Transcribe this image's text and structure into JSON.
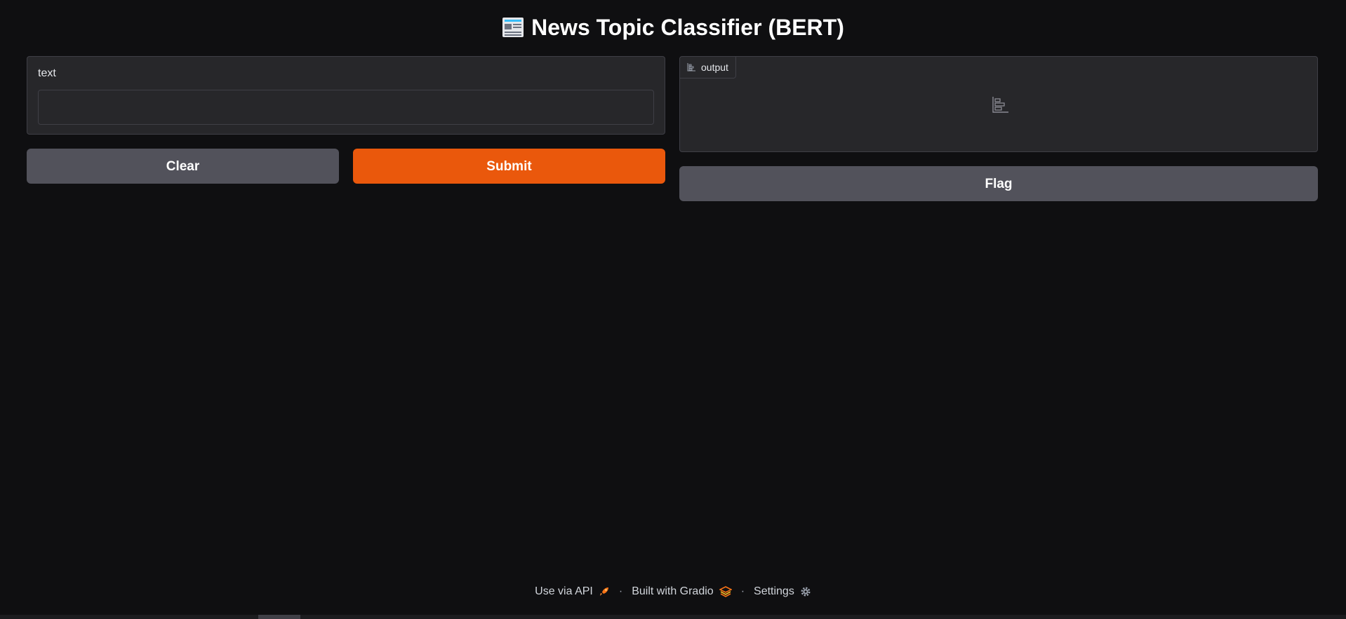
{
  "header": {
    "title": "News Topic Classifier (BERT)",
    "title_icon": "newspaper-icon"
  },
  "input": {
    "label": "text",
    "value": "",
    "placeholder": ""
  },
  "buttons": {
    "clear_label": "Clear",
    "submit_label": "Submit",
    "flag_label": "Flag"
  },
  "output": {
    "label": "output",
    "label_icon": "bar-chart-icon",
    "empty_icon": "bar-chart-icon"
  },
  "footer": {
    "api_label": "Use via API",
    "api_icon": "rocket-icon",
    "separator": "·",
    "gradio_label": "Built with Gradio",
    "gradio_icon": "gradio-logo-icon",
    "settings_label": "Settings",
    "settings_icon": "gear-icon"
  },
  "colors": {
    "background": "#0f0f11",
    "panel": "#27272a",
    "border": "#3f3f46",
    "secondary_button": "#52525b",
    "primary_button": "#ea580c"
  }
}
